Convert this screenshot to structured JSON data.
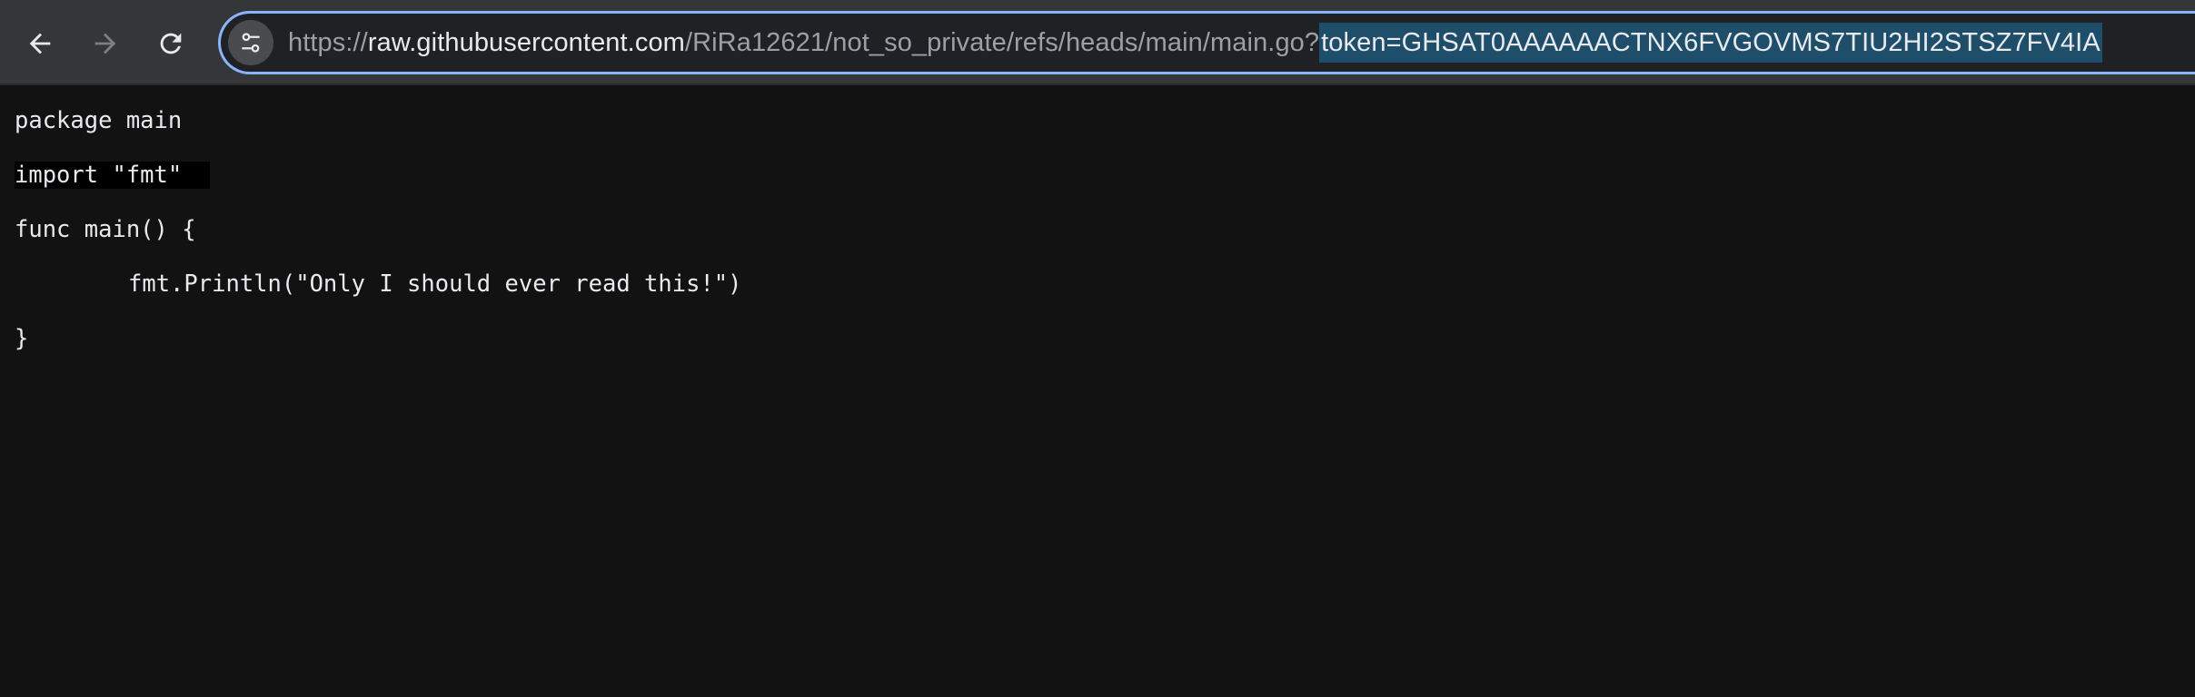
{
  "browser": {
    "url_scheme": "https://",
    "url_host": "raw.githubusercontent.com",
    "url_path": "/RiRa12621/not_so_private/refs/heads/main/main.go?",
    "url_query_selected": "token=GHSAT0AAAAAACTNX6FVGOVMS7TIU2HI2STSZ7FV4IA",
    "accent": "#8ab4f8",
    "selection_color": "#1f4e6a"
  },
  "icons": {
    "back": "arrow-left-icon",
    "forward": "arrow-right-icon",
    "reload": "reload-icon",
    "site_info": "tune-icon"
  },
  "code": {
    "line1": "package main",
    "line2": "import \"fmt\"",
    "line3": "func main() {",
    "line4": "fmt.Println(\"Only I should ever read this!\")",
    "line5": "}"
  }
}
